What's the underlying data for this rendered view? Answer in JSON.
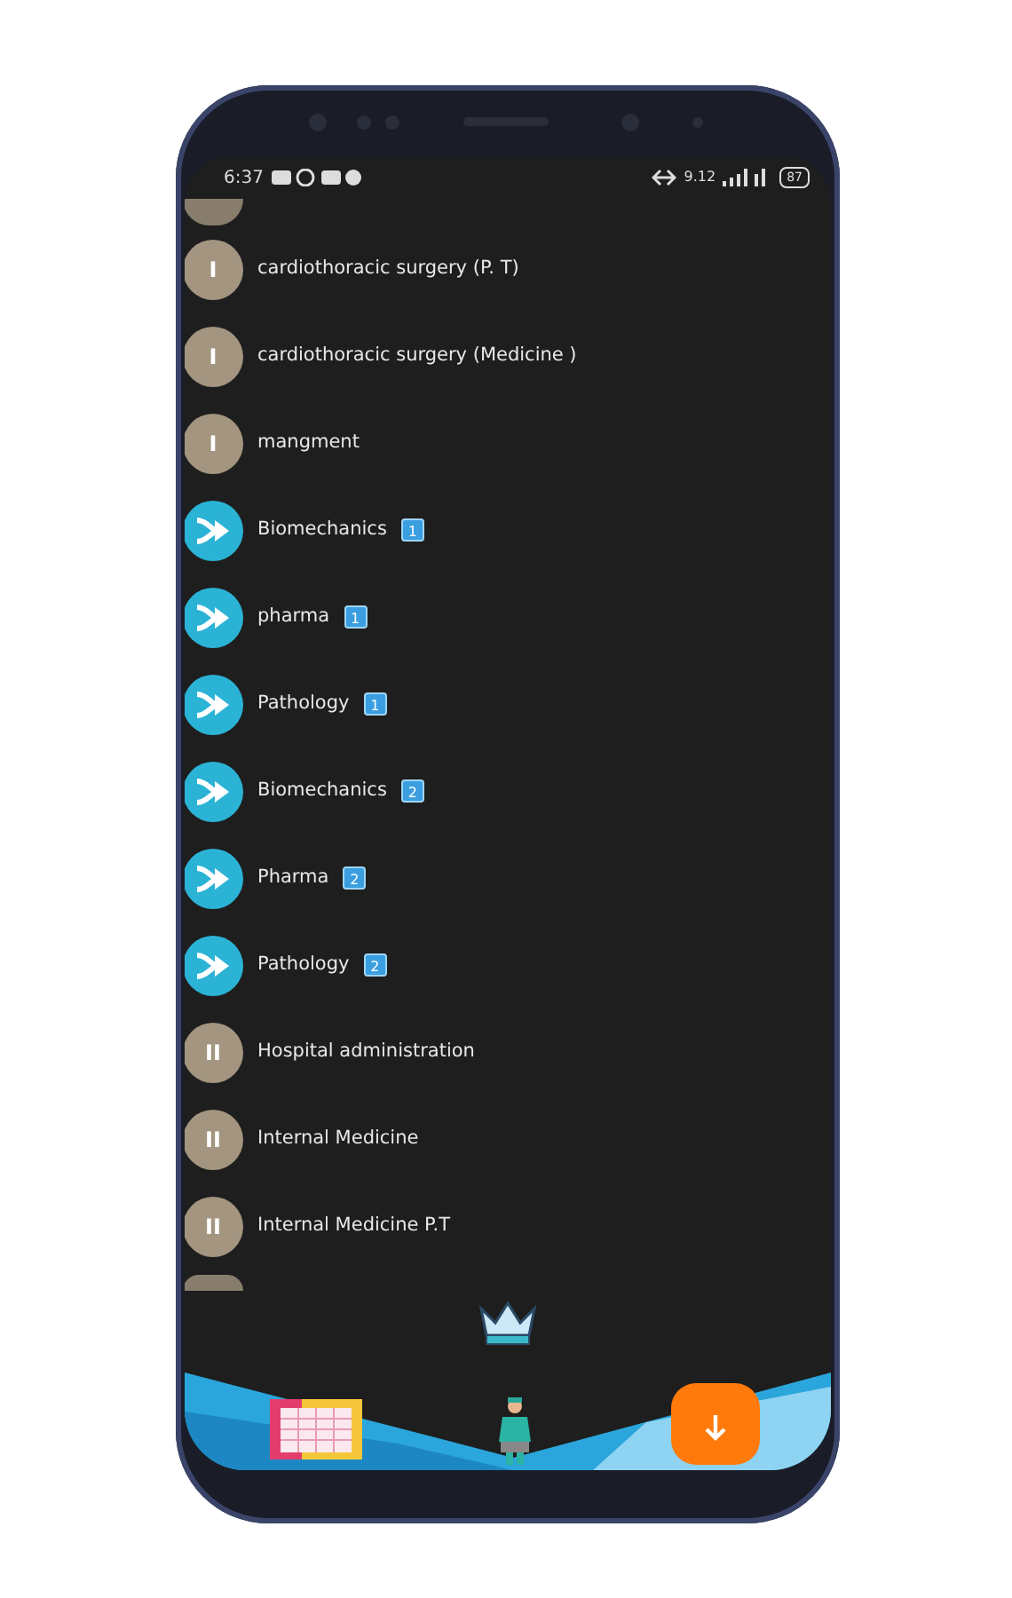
{
  "status_bar": {
    "time": "6:37",
    "net_speed": "9.12",
    "battery": "87"
  },
  "items": [
    {
      "kind": "roman",
      "numeral": "I",
      "label": "cardiothoracic surgery (P. T)"
    },
    {
      "kind": "roman",
      "numeral": "I",
      "label": "cardiothoracic surgery (Medicine )"
    },
    {
      "kind": "roman",
      "numeral": "I",
      "label": "mangment"
    },
    {
      "kind": "arrow",
      "label": "Biomechanics",
      "badge": "1"
    },
    {
      "kind": "arrow",
      "label": "pharma",
      "badge": "1"
    },
    {
      "kind": "arrow",
      "label": "Pathology",
      "badge": "1"
    },
    {
      "kind": "arrow",
      "label": "Biomechanics",
      "badge": "2"
    },
    {
      "kind": "arrow",
      "label": "Pharma",
      "badge": "2"
    },
    {
      "kind": "arrow",
      "label": "Pathology",
      "badge": "2"
    },
    {
      "kind": "roman",
      "numeral": "II",
      "label": "Hospital administration"
    },
    {
      "kind": "roman",
      "numeral": "II",
      "label": "Internal Medicine"
    },
    {
      "kind": "roman",
      "numeral": "II",
      "label": "Internal Medicine P.T"
    }
  ]
}
